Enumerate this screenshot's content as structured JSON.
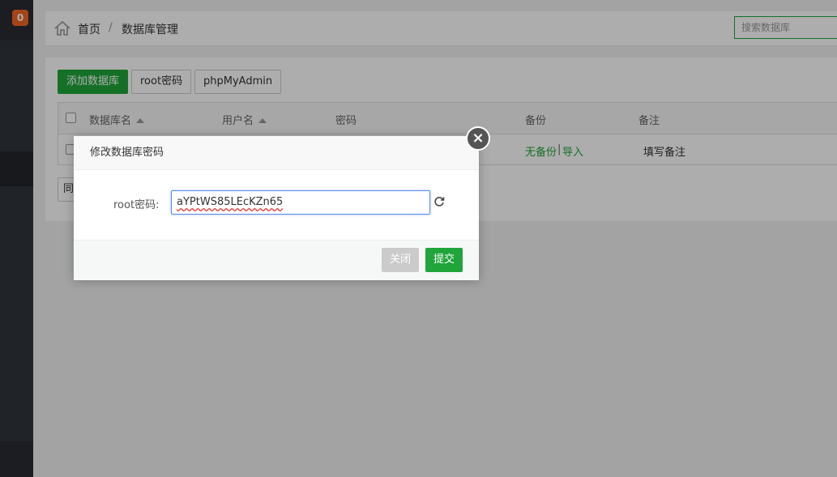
{
  "sidebar": {
    "badge": "0"
  },
  "breadcrumb": {
    "home": "首页",
    "separator": "/",
    "current": "数据库管理"
  },
  "search": {
    "placeholder": "搜索数据库"
  },
  "toolbar": {
    "add_db": "添加数据库",
    "root_password": "root密码",
    "phpmyadmin": "phpMyAdmin"
  },
  "table": {
    "headers": {
      "db_name": "数据库名",
      "username": "用户名",
      "password": "密码",
      "backup": "备份",
      "notes": "备注"
    },
    "row": {
      "backup_none": "无备份",
      "backup_sep": "|",
      "backup_import": "导入",
      "notes": "填写备注"
    }
  },
  "bottom_button_fragment": "同",
  "dialog": {
    "title": "修改数据库密码",
    "field_label": "root密码:",
    "field_value": "aYPtWS85LEcKZn65",
    "close_label": "关闭",
    "submit_label": "提交"
  },
  "colors": {
    "accent": "#20a53a",
    "badge": "#f26522",
    "sidebar": "#30353d"
  },
  "icons": [
    "home-icon",
    "refresh-icon",
    "close-icon",
    "sort-up-icon"
  ]
}
